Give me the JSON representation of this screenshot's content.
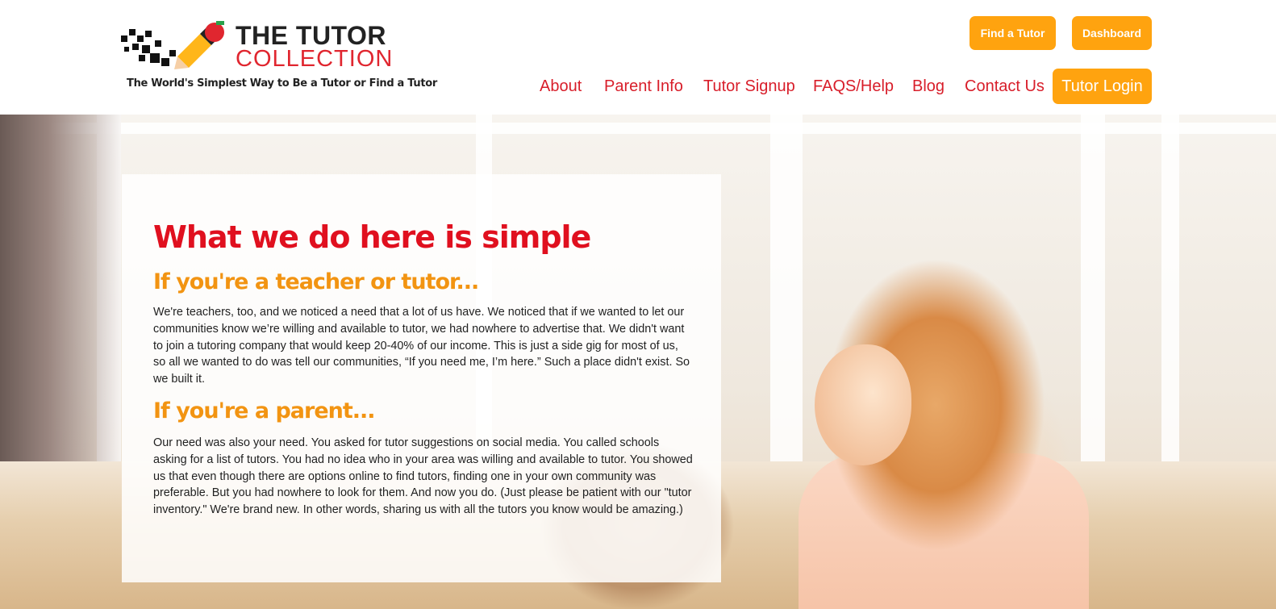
{
  "logo": {
    "title": "THE TUTOR",
    "subtitle": "COLLECTION",
    "tagline": "The World's Simplest Way to Be a Tutor or Find a Tutor"
  },
  "header_buttons": {
    "find_tutor": "Find a Tutor",
    "dashboard": "Dashboard"
  },
  "nav": {
    "items": [
      "About",
      "Parent Info",
      "Tutor Signup",
      "FAQS/Help",
      "Blog",
      "Contact Us"
    ],
    "login": "Tutor Login"
  },
  "colors": {
    "accent_orange": "#ffa30f",
    "brand_red": "#e0101f",
    "nav_red": "#d81e2a",
    "heading_orange": "#f29412"
  },
  "hero": {
    "heading": "What we do here is simple",
    "teacher_heading": "If you're a teacher or tutor...",
    "teacher_text": "We're teachers, too, and we noticed a need that a lot of us have. We noticed that if we wanted to let our communities know we’re willing and available to tutor, we had nowhere to advertise that. We didn't want to join a tutoring company that would keep 20-40% of our income. This is just a side gig for most of us, so all we wanted to do was tell our communities, “If you need me, I’m here.” Such a place didn't exist. So we built it.",
    "parent_heading": "If you're a parent...",
    "parent_text": "Our need was also your need. You asked for tutor suggestions on social media. You called schools asking for a list of tutors. You had no idea who in your area was willing and available to tutor. You showed us that even though there are options online to find tutors, finding one in your own community was preferable. But you had nowhere to look for them. And now you do. (Just please be patient with our \"tutor inventory.\" We're brand new. In other words, sharing us with all the tutors you know would be amazing.)"
  }
}
